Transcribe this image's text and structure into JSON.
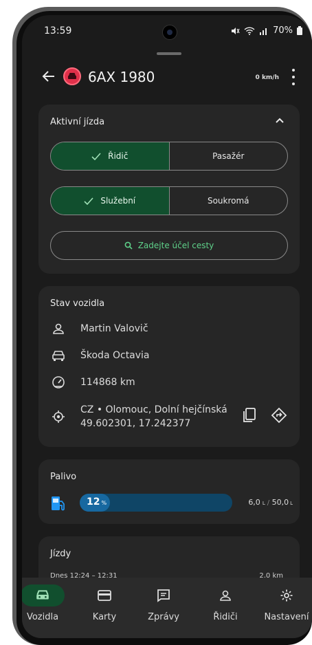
{
  "status": {
    "time": "13:59",
    "battery": "70%"
  },
  "header": {
    "plate": "6AX 1980",
    "speed": "0 km/h"
  },
  "active_trip": {
    "title": "Aktivní jízda",
    "role_options": [
      "Řidič",
      "Pasažér"
    ],
    "selected_role": "Řidič",
    "type_options": [
      "Služební",
      "Soukromá"
    ],
    "selected_type": "Služební",
    "purpose_placeholder": "Zadejte účel cesty"
  },
  "vehicle_state": {
    "title": "Stav vozidla",
    "driver": "Martin Valovič",
    "car": "Škoda Octavia",
    "odometer": "114868 km",
    "location_line1": "CZ • Olomouc, Dolní hejčínská",
    "location_line2": "49.602301, 17.242377"
  },
  "fuel": {
    "title": "Palivo",
    "percent": 12,
    "percent_label": "12",
    "unit": "%",
    "amount_current": "6,0",
    "amount_total": "50,0",
    "amount_unit": "L"
  },
  "trips": {
    "title": "Jízdy",
    "first_time": "Dnes 12:24 – 12:31",
    "first_distance": "2,0 km"
  },
  "nav": {
    "items": [
      {
        "label": "Vozidla",
        "icon": "car-icon"
      },
      {
        "label": "Karty",
        "icon": "card-icon"
      },
      {
        "label": "Zprávy",
        "icon": "message-icon"
      },
      {
        "label": "Řidiči",
        "icon": "person-icon"
      },
      {
        "label": "Nastavení",
        "icon": "gear-icon"
      }
    ],
    "active": "Vozidla"
  },
  "colors": {
    "accent": "#114f2e",
    "accent_text": "#5fd18a",
    "fuel": "#2196f3",
    "badge": "#e0304a"
  }
}
